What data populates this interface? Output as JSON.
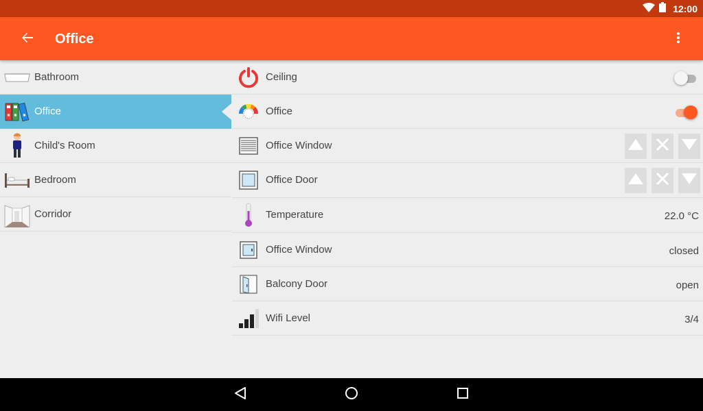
{
  "status_bar": {
    "time": "12:00",
    "icons": [
      "wifi-icon",
      "battery-icon"
    ]
  },
  "app_bar": {
    "title": "Office",
    "back_icon": "arrow-back-icon",
    "menu_icon": "more-vert-icon",
    "color": "#ff5722"
  },
  "rooms": [
    {
      "label": "Bathroom",
      "icon": "bathtub-icon"
    },
    {
      "label": "Office",
      "icon": "binders-icon",
      "selected": true
    },
    {
      "label": "Child's Room",
      "icon": "child-icon"
    },
    {
      "label": "Bedroom",
      "icon": "bed-icon"
    },
    {
      "label": "Corridor",
      "icon": "corridor-icon"
    }
  ],
  "items": [
    {
      "label": "Ceiling",
      "icon": "power-icon",
      "control": "switch",
      "on": false
    },
    {
      "label": "Office",
      "icon": "color-dial-icon",
      "control": "switch",
      "on": true
    },
    {
      "label": "Office Window",
      "icon": "rollershutter-icon",
      "control": "rollershutter"
    },
    {
      "label": "Office Door",
      "icon": "door-frame-icon",
      "control": "rollershutter"
    },
    {
      "label": "Temperature",
      "icon": "thermometer-icon",
      "value": "22.0 °C"
    },
    {
      "label": "Office Window",
      "icon": "window-closed-icon",
      "value": "closed"
    },
    {
      "label": "Balcony Door",
      "icon": "door-open-icon",
      "value": "open"
    },
    {
      "label": "Wifi Level",
      "icon": "signal-bars-icon",
      "value": "3/4"
    }
  ],
  "nav_bar": {
    "icons": [
      "nav-back-icon",
      "nav-home-icon",
      "nav-recents-icon"
    ]
  },
  "colors": {
    "status_bar": "#c0390f",
    "accent": "#ff5722",
    "selected_room": "#64bcdc"
  }
}
